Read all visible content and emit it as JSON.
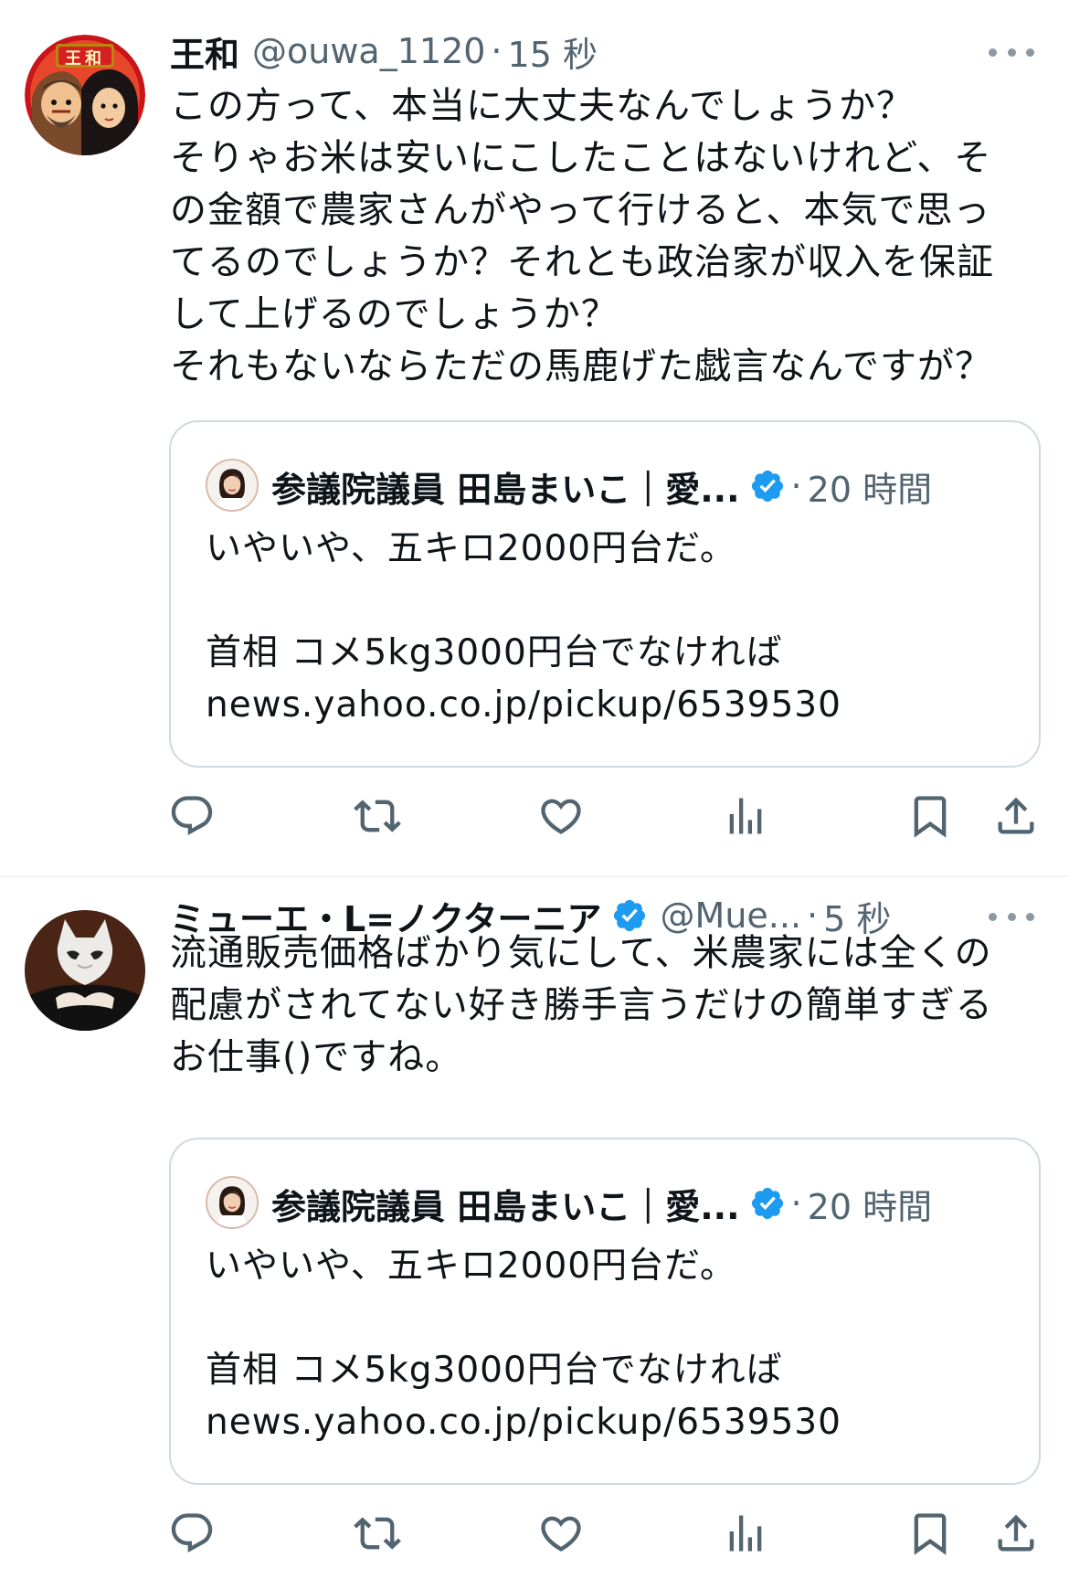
{
  "colors": {
    "text": "#0f1419",
    "secondary": "#536471",
    "border": "#cfd9de",
    "verified": "#1d9bf0"
  },
  "tweets": [
    {
      "display_name": "王和",
      "handle": "@ouwa_1120",
      "separator": "·",
      "time": "15 秒",
      "avatar_badge": "王和",
      "text": "この方って、本当に大丈夫なんでしょうか？\nそりゃお米は安いにこしたことはないけれど、そ\nの金額で農家さんがやって行けると、本気で思っ\nてるのでしょうか？それとも政治家が収入を保証\nして上げるのでしょうか？\nそれもないならただの馬鹿げた戯言なんですが？",
      "quote": {
        "display_name": "参議院議員 田島まいこ｜愛...",
        "separator": "·",
        "time": "20 時間",
        "text": "いやいや、五キロ2000円台だ。\n\n首相 コメ5kg3000円台でなければ\nnews.yahoo.co.jp/pickup/6539530"
      },
      "actions": [
        "reply-icon",
        "retweet-icon",
        "like-icon",
        "views-icon",
        "bookmark-icon",
        "share-icon"
      ]
    },
    {
      "display_name": "ミューエ・L=ノクターニア",
      "handle": "@Mue...",
      "separator": "·",
      "time": "5 秒",
      "text": "流通販売価格ばかり気にして、米農家には全くの\n配慮がされてない好き勝手言うだけの簡単すぎる\nお仕事()ですね。",
      "quote": {
        "display_name": "参議院議員 田島まいこ｜愛...",
        "separator": "·",
        "time": "20 時間",
        "text": "いやいや、五キロ2000円台だ。\n\n首相 コメ5kg3000円台でなければ\nnews.yahoo.co.jp/pickup/6539530"
      },
      "actions": [
        "reply-icon",
        "retweet-icon",
        "like-icon",
        "views-icon",
        "bookmark-icon",
        "share-icon"
      ]
    }
  ]
}
